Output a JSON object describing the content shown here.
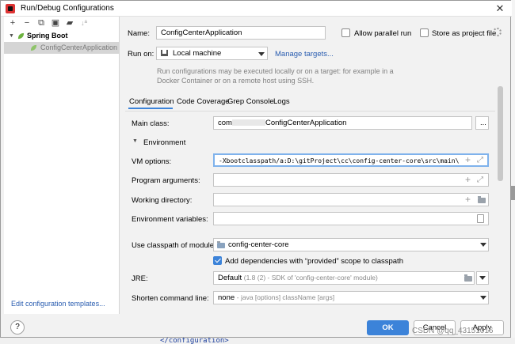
{
  "window": {
    "title": "Run/Debug Configurations",
    "close_glyph": "✕"
  },
  "toolbar": {
    "add": "+",
    "remove": "−",
    "copy": "⧉",
    "save": "▣",
    "folder": "▰",
    "sort": "↓ª"
  },
  "tree": {
    "group_label": "Spring Boot",
    "item_label": "ConfigCenterApplication"
  },
  "left_footer": {
    "edit_templates": "Edit configuration templates..."
  },
  "form": {
    "name_label": "Name:",
    "name_value": "ConfigCenterApplication",
    "allow_parallel_label": "Allow parallel run",
    "allow_parallel_checked": false,
    "store_as_file_label": "Store as project file",
    "store_as_file_checked": false,
    "run_on_label": "Run on:",
    "run_on_value": "Local machine",
    "manage_targets": "Manage targets...",
    "help_text": "Run configurations may be executed locally or on a target: for example in a Docker Container or on a remote host using SSH."
  },
  "tabs": [
    {
      "label": "Configuration",
      "active": true
    },
    {
      "label": "Code Coverage",
      "active": false
    },
    {
      "label": "Grep Console",
      "active": false
    },
    {
      "label": "Logs",
      "active": false
    }
  ],
  "config": {
    "main_class_label": "Main class:",
    "main_class_prefix": "com",
    "main_class_value": "ConfigCenterApplication",
    "main_class_browse": "...",
    "environment_label": "Environment",
    "vm_options_label": "VM options:",
    "vm_options_value": "-Xbootclasspath/a:D:\\gitProject\\cc\\config-center-core\\src\\main\\",
    "program_args_label": "Program arguments:",
    "program_args_value": "",
    "working_dir_label": "Working directory:",
    "working_dir_value": "",
    "env_vars_label": "Environment variables:",
    "env_vars_value": "",
    "classpath_label": "Use classpath of module:",
    "classpath_value": "config-center-core",
    "add_deps_label": "Add dependencies with “provided” scope to classpath",
    "add_deps_checked": true,
    "jre_label": "JRE:",
    "jre_value": "Default",
    "jre_detail": "(1.8 (2) - SDK of 'config-center-core' module)",
    "shorten_label": "Shorten command line:",
    "shorten_value": "none",
    "shorten_detail": "- java [options] className [args]"
  },
  "buttons": {
    "help": "?",
    "ok": "OK",
    "cancel": "Cancel",
    "apply": "Apply"
  },
  "watermark": "CSDN @qq_43151016",
  "background_code": "</configuration>",
  "colors": {
    "accent": "#3c83d9",
    "link": "#2a5db0",
    "spring_green": "#6db33f"
  }
}
